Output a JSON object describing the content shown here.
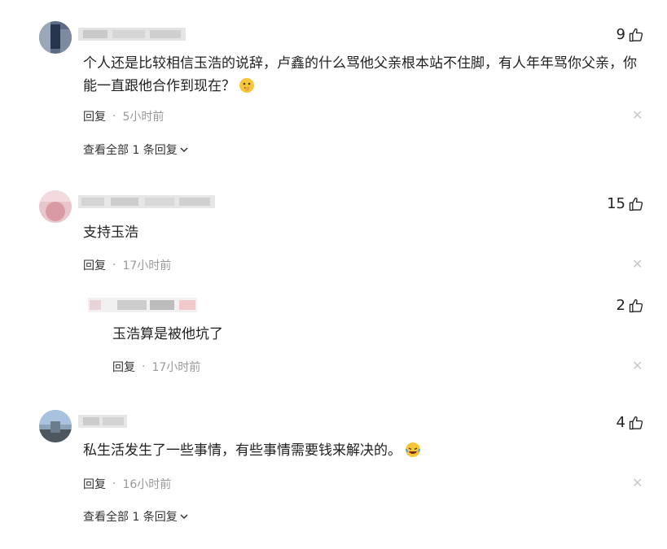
{
  "comments": [
    {
      "likes": "9",
      "text": "个人还是比较相信玉浩的说辞，卢鑫的什么骂他父亲根本站不住脚，有人年年骂你父亲，你能一直跟他合作到现在？",
      "emoji": "thinking-face",
      "reply_label": "回复",
      "dot": "·",
      "time": "5小时前",
      "view_replies": "查看全部 1 条回复"
    },
    {
      "likes": "15",
      "text": "支持玉浩",
      "reply_label": "回复",
      "dot": "·",
      "time": "17小时前"
    },
    {
      "likes": "2",
      "text": "玉浩算是被他坑了",
      "reply_label": "回复",
      "dot": "·",
      "time": "17小时前"
    },
    {
      "likes": "4",
      "text": "私生活发生了一些事情，有些事情需要钱来解决的。",
      "emoji": "laughing-crying-face",
      "reply_label": "回复",
      "dot": "·",
      "time": "16小时前",
      "view_replies": "查看全部 1 条回复"
    }
  ],
  "icons": {
    "like": "thumbs-up-icon",
    "close": "close-icon",
    "chevron": "chevron-down-icon"
  }
}
